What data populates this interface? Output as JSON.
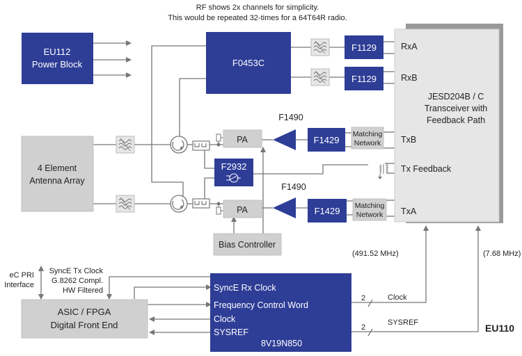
{
  "note": {
    "line1": "RF shows 2x channels for simplicity.",
    "line2": "This would be repeated 32-times for a 64T64R radio."
  },
  "colors": {
    "blue_block": "#2e3d96",
    "gray_block": "#d0d0d0",
    "light_gray_block": "#e6e6e6",
    "line": "#777777",
    "shadow": "#999999"
  },
  "blocks": {
    "power": {
      "line1": "EU112",
      "line2": "Power Block"
    },
    "f0453c": {
      "label": "F0453C"
    },
    "f1129_a": {
      "label": "F1129"
    },
    "f1129_b": {
      "label": "F1129"
    },
    "transceiver": {
      "line1": "JESD204B / C",
      "line2": "Transceiver with",
      "line3": "Feedback Path"
    },
    "antenna": {
      "line1": "4 Element",
      "line2": "Antenna Array"
    },
    "pa_top": {
      "label": "PA"
    },
    "pa_bottom": {
      "label": "PA"
    },
    "f1490_top": {
      "label": "F1490"
    },
    "f1490_bottom": {
      "label": "F1490"
    },
    "f1429_top": {
      "label": "F1429"
    },
    "f1429_bottom": {
      "label": "F1429"
    },
    "matching_top": {
      "line1": "Matching",
      "line2": "Network"
    },
    "matching_bottom": {
      "line1": "Matching",
      "line2": "Network"
    },
    "f2932": {
      "label": "F2932"
    },
    "bias": {
      "label": "Bias Controller"
    },
    "asic": {
      "line1": "ASIC / FPGA",
      "line2": "Digital Front End"
    },
    "clock_chip": {
      "port1": "SyncE Rx Clock",
      "port2": "Frequency Control Word",
      "port3": "Clock",
      "port4": "SYSREF",
      "part": "8V19N850"
    }
  },
  "ports": {
    "rxa": "RxA",
    "rxb": "RxB",
    "txb": "TxB",
    "tx_feedback": "Tx Feedback",
    "txa": "TxA"
  },
  "labels": {
    "freq_clock": "(491.52 MHz)",
    "freq_sysref": "(7.68 MHz)",
    "ecpri_1": "eC PRI",
    "ecpri_2": "Interface",
    "synce_1": "SyncE Tx Clock",
    "synce_2": "G.8262 Compl.",
    "synce_3": "HW Filtered",
    "bus_clock_count": "2",
    "bus_clock_name": "Clock",
    "bus_sysref_count": "2",
    "bus_sysref_name": "SYSREF",
    "eu110": "EU110"
  }
}
